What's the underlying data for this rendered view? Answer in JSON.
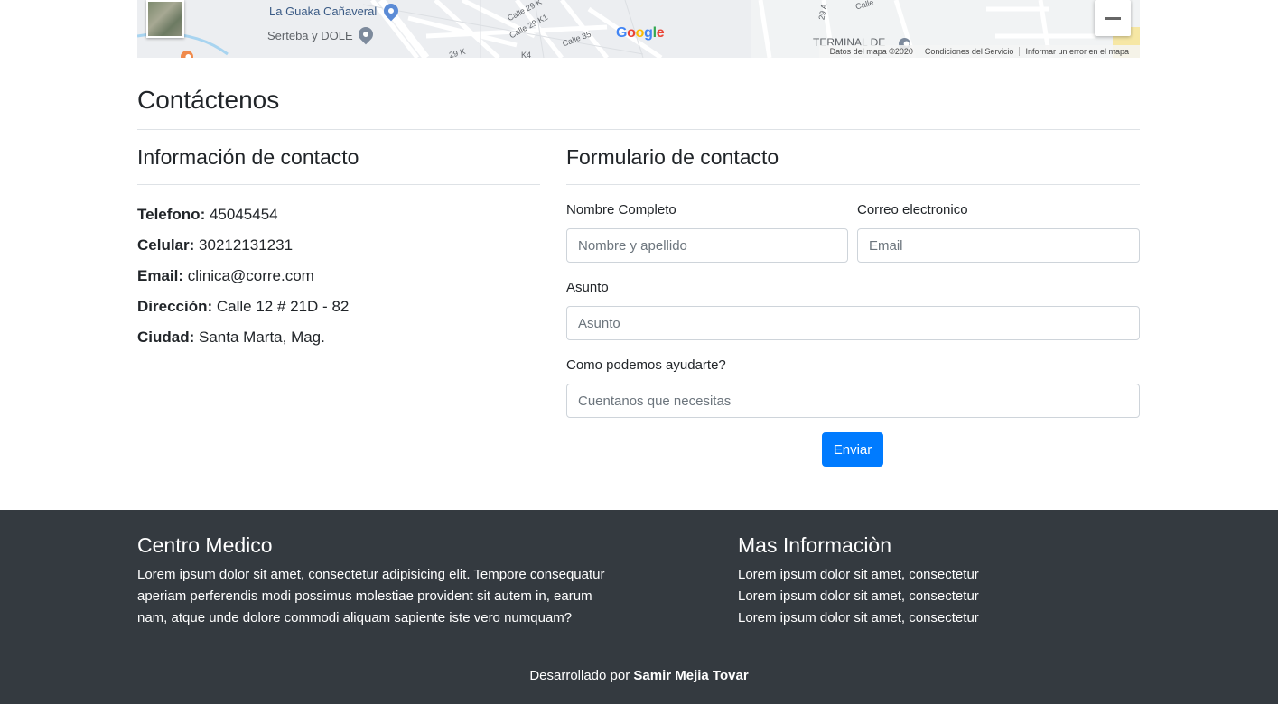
{
  "map": {
    "labels": {
      "place_1": "La Guaka Cañaveral",
      "place_2": "Serteba y DOLE",
      "terminal": "TERMINAL DE",
      "street_1": "Calle 29 K",
      "street_2": "Calle 29 K1",
      "street_3": "Calle 35",
      "street_4": "29 A",
      "street_5": "Calle",
      "street_6": "29 K",
      "street_7": "K4"
    },
    "google_logo": [
      "G",
      "o",
      "o",
      "g",
      "l",
      "e"
    ],
    "google_colors": [
      "#4285F4",
      "#EA4335",
      "#FBBC05",
      "#4285F4",
      "#34A853",
      "#EA4335"
    ],
    "attribution": {
      "data": "Datos del mapa ©2020",
      "terms": "Condiciones del Servicio",
      "report": "Informar un error en el mapa"
    },
    "zoom_out_icon": "minus-icon"
  },
  "contact": {
    "title": "Contáctenos",
    "info": {
      "title": "Información de contacto",
      "items": [
        {
          "label": "Telefono:",
          "value": "45045454"
        },
        {
          "label": "Celular:",
          "value": "30212131231"
        },
        {
          "label": "Email:",
          "value": "clinica@corre.com"
        },
        {
          "label": "Dirección:",
          "value": "Calle 12 # 21D - 82"
        },
        {
          "label": "Ciudad:",
          "value": "Santa Marta, Mag."
        }
      ]
    },
    "form": {
      "title": "Formulario de contacto",
      "name_label": "Nombre Completo",
      "name_placeholder": "Nombre y apellido",
      "email_label": "Correo electronico",
      "email_placeholder": "Email",
      "subject_label": "Asunto",
      "subject_placeholder": "Asunto",
      "message_label": "Como podemos ayudarte?",
      "message_placeholder": "Cuentanos que necesitas",
      "submit_label": "Enviar"
    }
  },
  "footer": {
    "left_title": "Centro Medico",
    "left_text": "Lorem ipsum dolor sit amet, consectetur adipisicing elit. Tempore consequatur aperiam perferendis modi possimus molestiae provident sit autem in, earum nam, atque unde dolore commodi aliquam sapiente iste vero numquam?",
    "right_title": "Mas Informaciòn",
    "right_lines": [
      "Lorem ipsum dolor sit amet, consectetur",
      "Lorem ipsum dolor sit amet, consectetur",
      "Lorem ipsum dolor sit amet, consectetur"
    ],
    "credit_prefix": "Desarrollado por",
    "credit_name": "Samir Mejia Tovar"
  },
  "colors": {
    "primary": "#007bff",
    "footer_bg": "#343a40",
    "pin_blue": "#5b8bd6",
    "pin_gray": "#7d8a9c",
    "pin_orange": "#f08a4b"
  }
}
